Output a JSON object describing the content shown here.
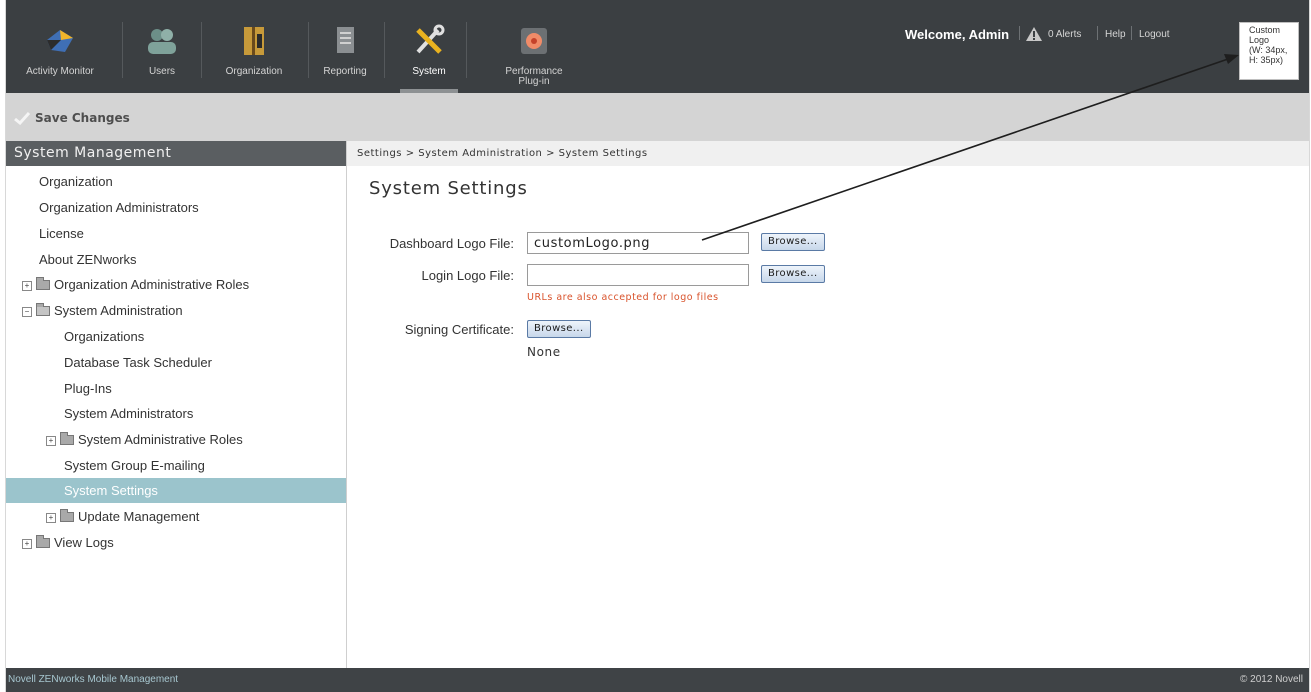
{
  "nav": {
    "items": [
      {
        "label": "Activity Monitor",
        "icon": "activity-monitor-icon"
      },
      {
        "label": "Users",
        "icon": "users-icon"
      },
      {
        "label": "Organization",
        "icon": "organization-icon"
      },
      {
        "label": "Reporting",
        "icon": "reporting-icon"
      },
      {
        "label": "System",
        "icon": "system-tools-icon",
        "active": true
      },
      {
        "label": "Performance",
        "label2": "Plug-in",
        "icon": "performance-plugin-icon"
      }
    ]
  },
  "header": {
    "welcome": "Welcome, Admin",
    "alerts": "0 Alerts",
    "help": "Help",
    "logout": "Logout",
    "custom_logo": "Custom\nLogo\n(W: 34px,\nH: 35px)"
  },
  "toolbar": {
    "save_label": "Save Changes"
  },
  "sidebar": {
    "title": "System Management",
    "items": [
      {
        "label": "Organization"
      },
      {
        "label": "Organization Administrators"
      },
      {
        "label": "License"
      },
      {
        "label": "About ZENworks"
      },
      {
        "label": "Organization Administrative Roles"
      },
      {
        "label": "System Administration"
      },
      {
        "label": "Organizations"
      },
      {
        "label": "Database Task Scheduler"
      },
      {
        "label": "Plug-Ins"
      },
      {
        "label": "System Administrators"
      },
      {
        "label": "System Administrative Roles"
      },
      {
        "label": "System Group E-mailing"
      },
      {
        "label": "System Settings"
      },
      {
        "label": "Update Management"
      },
      {
        "label": "View Logs"
      }
    ]
  },
  "main": {
    "breadcrumb": "Settings > System Administration > System Settings",
    "title": "System Settings",
    "dashboard_logo_label": "Dashboard Logo File:",
    "dashboard_logo_value": "customLogo.png",
    "login_logo_label": "Login Logo File:",
    "login_logo_value": "",
    "browse_label": "Browse...",
    "hint": "URLs are also accepted for logo files",
    "signing_cert_label": "Signing Certificate:",
    "signing_cert_value": "None"
  },
  "footer": {
    "left": "Novell ZENworks Mobile Management",
    "right": "© 2012 Novell"
  },
  "colors": {
    "topbar": "#3b3f42",
    "selected": "#9bc4cc",
    "hint": "#d9532c"
  }
}
